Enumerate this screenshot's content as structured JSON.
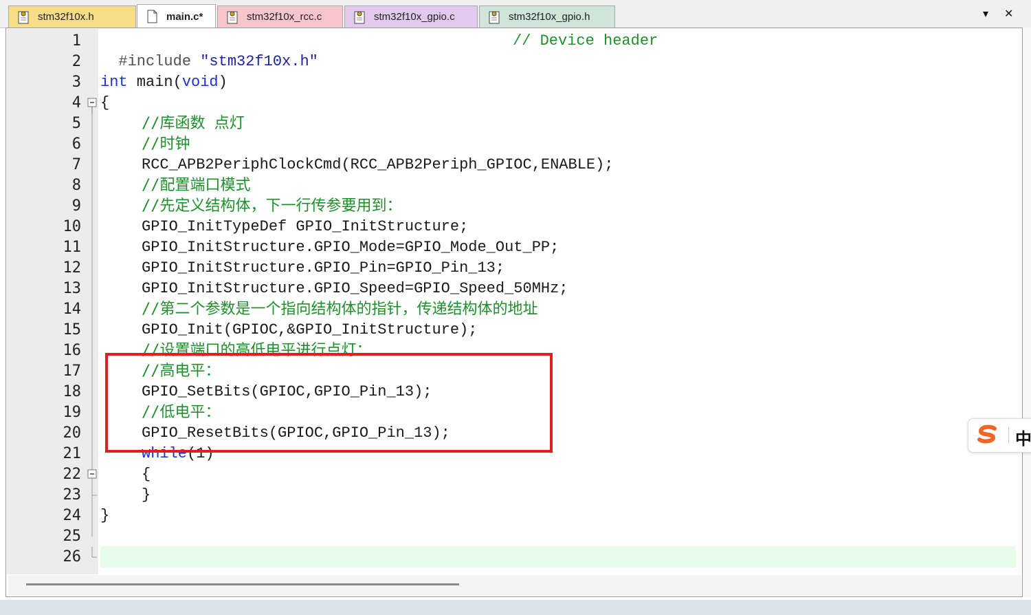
{
  "tabs": [
    {
      "label": "stm32f10x.h",
      "color": "#f7dd88",
      "active": false
    },
    {
      "label": "main.c*",
      "color": "#ffffff",
      "active": true
    },
    {
      "label": "stm32f10x_rcc.c",
      "color": "#f6c6cc",
      "active": false
    },
    {
      "label": "stm32f10x_gpio.c",
      "color": "#e2c9ee",
      "active": false
    },
    {
      "label": "stm32f10x_gpio.h",
      "color": "#cfe4da",
      "active": false
    }
  ],
  "tab_controls": {
    "dropdown": "▾",
    "close": "✕"
  },
  "editor": {
    "current_line": 26,
    "line_numbers": [
      "1",
      "2",
      "3",
      "4",
      "5",
      "6",
      "7",
      "8",
      "9",
      "10",
      "11",
      "12",
      "13",
      "14",
      "15",
      "16",
      "17",
      "18",
      "19",
      "20",
      "21",
      "22",
      "23",
      "24",
      "25",
      "26"
    ],
    "lines": {
      "l1_directive": "#include",
      "l1_header": "\"stm32f10x.h\"",
      "l1_comment": "// Device header",
      "l3_type": "int",
      "l3_name": " main(",
      "l3_param": "void",
      "l3_close": ")",
      "l4": "{",
      "l5": "//库函数 点灯",
      "l6": "//时钟",
      "l7": "RCC_APB2PeriphClockCmd(RCC_APB2Periph_GPIOC,ENABLE);",
      "l8": "//配置端口模式",
      "l9": "//先定义结构体，下一行传参要用到：",
      "l10": "GPIO_InitTypeDef GPIO_InitStructure;",
      "l11": "GPIO_InitStructure.GPIO_Mode=GPIO_Mode_Out_PP;",
      "l12": "GPIO_InitStructure.GPIO_Pin=GPIO_Pin_13;",
      "l13": "GPIO_InitStructure.GPIO_Speed=GPIO_Speed_50MHz;",
      "l14": "//第二个参数是一个指向结构体的指针，传递结构体的地址",
      "l15": "GPIO_Init(GPIOC,&GPIO_InitStructure);",
      "l16": "//设置端口的高低电平进行点灯：",
      "l17": "//高电平：",
      "l18": "GPIO_SetBits(GPIOC,GPIO_Pin_13);",
      "l19": "//低电平：",
      "l20": "GPIO_ResetBits(GPIOC,GPIO_Pin_13);",
      "l21_kw": "while",
      "l21_rest": "(1)",
      "l22": "{",
      "l23": "}",
      "l24": "}"
    }
  },
  "ime": {
    "mode": "中",
    "logo": "sogou-ime-logo"
  },
  "colors": {
    "keyword": "#1d2fd6",
    "comment": "#1f8f2b",
    "string": "#1d24a0",
    "highlight_box": "#e02020",
    "current_line_bg": "#e6fbe8"
  }
}
